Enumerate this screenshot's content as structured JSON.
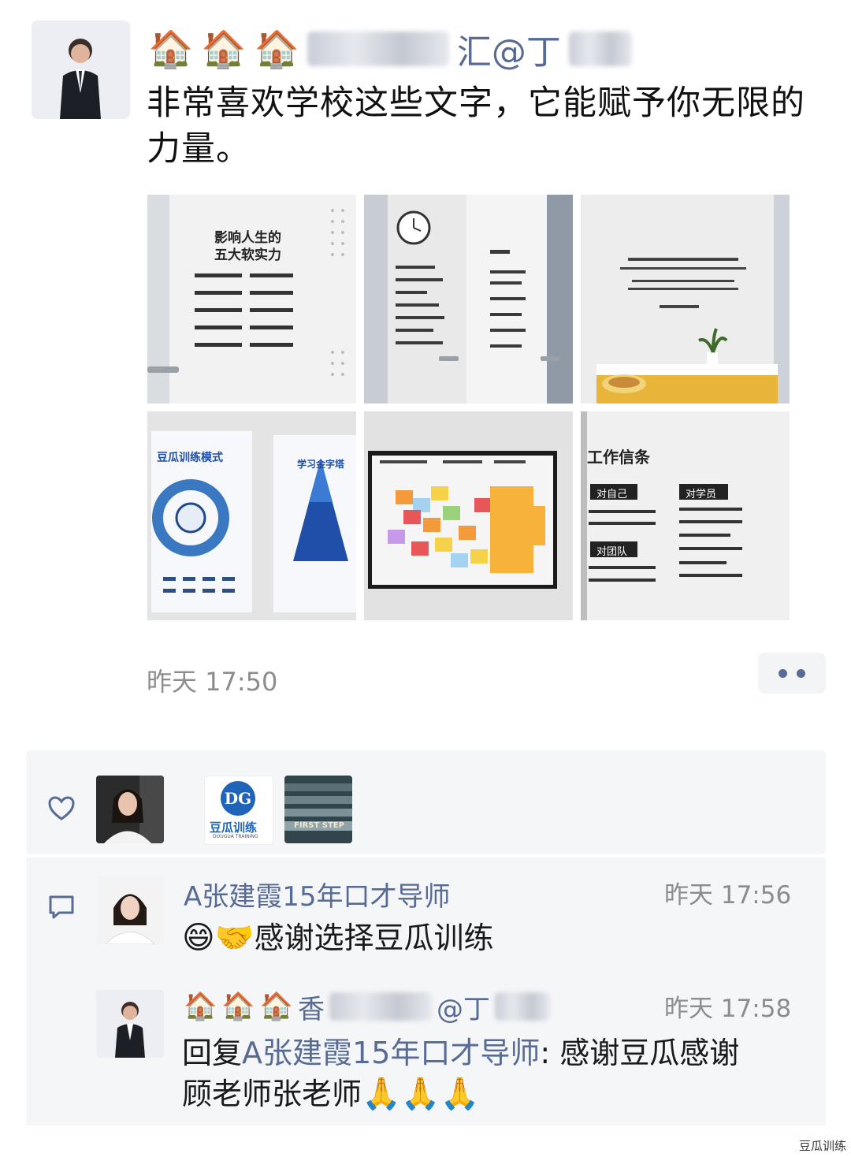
{
  "post": {
    "author_prefix_icons": [
      "house-icon",
      "house-icon",
      "house-icon"
    ],
    "author_name_visible": "汇@丁",
    "text": "非常喜欢学校这些文字，它能赋予你无限的力量。",
    "text_line1": "非常喜欢学校这些文字，它能赋予你无限的",
    "text_line2": "力量。",
    "photos": [
      {
        "title": "影响人生的",
        "subtitle": "五大软实力"
      },
      {
        "title": "",
        "subtitle": ""
      },
      {
        "title": "",
        "subtitle": ""
      },
      {
        "title": "豆瓜训练模式",
        "subtitle": "学习金字塔"
      },
      {
        "title": "",
        "subtitle": ""
      },
      {
        "title": "工作信条",
        "subtitle": ""
      }
    ],
    "photo6": {
      "self_label": "对自己",
      "team_label": "对团队",
      "student_label": "对学员"
    },
    "time": "昨天 17:50"
  },
  "likes": {
    "icon": "heart-icon",
    "avatars": [
      {
        "name": "liker-avatar-woman"
      },
      {
        "name": "liker-avatar-dougua",
        "logo_text": "DG",
        "label": "豆瓜训练",
        "sublabel": "DOUGUA TRAINING"
      },
      {
        "name": "liker-avatar-first-step",
        "text": "FIRST STEP"
      }
    ]
  },
  "comments": {
    "icon": "comment-icon",
    "items": [
      {
        "name": "A张建霞15年口才导师",
        "time": "昨天 17:56",
        "emoji": "😄🤝",
        "text": "感谢选择豆瓜训练"
      },
      {
        "name_visible": "香",
        "name_visible2": "@丁",
        "time": "昨天 17:58",
        "reply_prefix": "回复",
        "reply_to": "A张建霞15年口才导师",
        "text_line1": ": 感谢豆瓜感谢",
        "text_line2": "顾老师张老师",
        "emoji": "🙏🙏🙏"
      }
    ]
  },
  "watermark": "豆瓜训练"
}
